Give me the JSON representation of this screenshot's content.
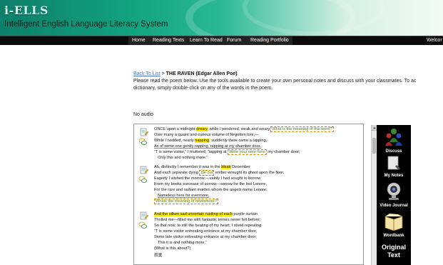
{
  "header": {
    "logo": "i-ELLS",
    "tagline": "Intelligent English Language Literacy System"
  },
  "nav": {
    "items": [
      "Home",
      "Reading Texts",
      "Learn To Read",
      "Forum",
      "Reading Portfolio"
    ],
    "welcome": "Welcor"
  },
  "breadcrumb": {
    "back_link": "Back To List",
    "separator": ">",
    "title": "THE RAVEN (Edgar Allen Poe)"
  },
  "instructions": {
    "line1": "Please read the poem below. Use the tools available to create your own personal notes and discuss with your classmates. To ac",
    "line2": "dictionary, simply double-click on any of the words in the poem."
  },
  "audio_status": "No audio",
  "poem": {
    "stanza1": {
      "l1_pre": "ONCE upon a midnight ",
      "l1_hl": "dreary",
      "l1_post": ", while I pondered, weak and weary,",
      "l1_note": "What is the meaning of this word?",
      "l2": "Over many a quaint and curious volume of forgotten lore,—",
      "l3_pre": "While I nodded, nearly ",
      "l3_hl": "napping",
      "l3_post": ", suddenly there came a tapping,",
      "l4": "As of some one gently rapping, rapping at my chamber door.",
      "l5_pre": "“T is some visitor,” I muttered, “tapping at ",
      "l5_note": "Write your note here",
      "l5_post": " my chamber door;",
      "l6": "Only this and nothing more.”"
    },
    "stanza2": {
      "l1_pre": "Ah, distinctly I remember it was in the ",
      "l1_hl": "bleak",
      "l1_post": " December",
      "l2_pre": "And each separate dying ",
      "l2_note": "die out",
      "l2_post": " ember wrought its ghost upon the floor.",
      "l3": "Eagerly I wished the morrow;—vainly I had sought to borrow",
      "l4": "From my books surcease of sorrow—sorrow for the lost Lenore,",
      "l5": "For the rare and radiant maiden whom the angels name Lenore:",
      "l6": "Nameless here for evermore.",
      "note": "Whats the meaning of nevermore?"
    },
    "stanza3": {
      "l1_hl": "And the silken sad uncertain rustling of each",
      "l1_post": " purple curtain",
      "l2": "Thrilled me—filled me with fantastic terrors never felt before;",
      "l3": "So that now, to still the beating of my heart, I stood repeating",
      "l4": "“T is some visitor entreating entrance at my chamber door,",
      "l5": "Some late visitor entreating entrance at my chamber door;",
      "l6": "This it is and nothing more.”",
      "question": "(What is this about?)",
      "extra": "寂寞"
    }
  },
  "tools": {
    "discuss": "Discuss",
    "my_notes": "My Notes",
    "video_journal": "Video Journal",
    "wordbank": "Wordbank",
    "original_text_1": "Original",
    "original_text_2": "Text"
  },
  "colors": {
    "header_teal": "#12a37f",
    "nav_black": "#0b0b0b",
    "highlight_yellow": "#ffee00",
    "link_blue": "#4a7ab8"
  }
}
